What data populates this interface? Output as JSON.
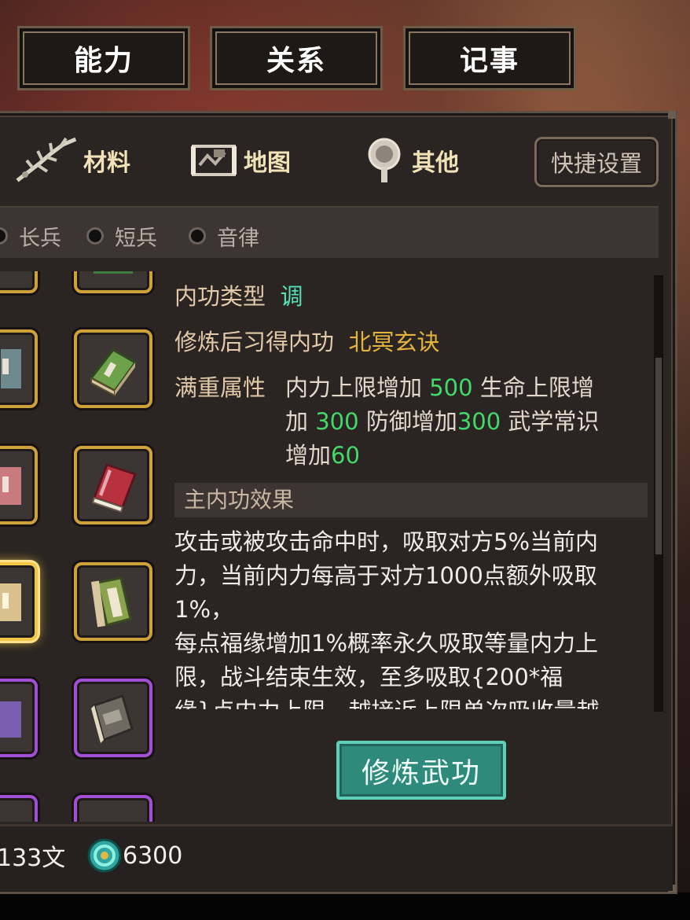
{
  "top_tabs": [
    "能力",
    "关系",
    "记事"
  ],
  "categories": [
    {
      "label": "材料",
      "icon": "herb-icon"
    },
    {
      "label": "地图",
      "icon": "map-icon"
    },
    {
      "label": "其他",
      "icon": "mirror-icon"
    }
  ],
  "quick_settings": "快捷设置",
  "filters": [
    "长兵",
    "短兵",
    "音律"
  ],
  "detail": {
    "type_label": "内功类型",
    "type_value": "调",
    "learn_label": "修炼后习得内功",
    "learn_value": "北冥玄诀",
    "full_label": "满重属性",
    "attr_line1_a": "内力上限增加",
    "attr_line1_n": "500",
    "attr_line1_b": "生命上限增",
    "attr_line2_a": "加",
    "attr_line2_n1": "300",
    "attr_line2_b": "防御增加",
    "attr_line2_n2": "300",
    "attr_line2_c": "武学常识",
    "attr_line3_a": "增加",
    "attr_line3_n": "60",
    "section_title": "主内功效果",
    "desc_lines": [
      "攻击或被攻击命中时，吸取对方5%当前内",
      "力，当前内力每高于对方1000点额外吸取",
      "1%，",
      "每点福缘增加1%概率永久吸取等量内力上",
      "限，战斗结束生效，至多吸取{200*福",
      "缘}点内力上限，越接近上限单次吸收量越"
    ]
  },
  "practice_button": "修炼武功",
  "footer": {
    "coins_text": "133文",
    "jade_text": "6300"
  },
  "colors": {
    "gold_border": "#cfa13a",
    "purple_border": "#a24fd6",
    "number_green": "#43d86a",
    "type_cyan": "#55e0b8",
    "skill_gold": "#e6b43c",
    "button_teal": "#2e8a7a"
  }
}
